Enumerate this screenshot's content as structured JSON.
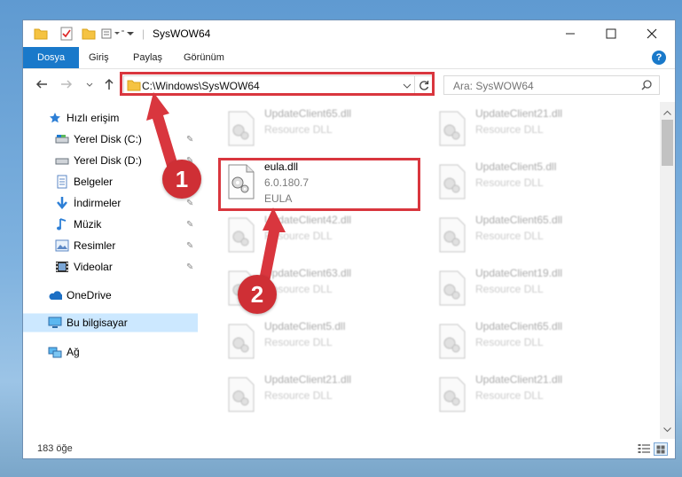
{
  "window": {
    "title": "SysWOW64",
    "controls": [
      "minimize-icon",
      "maximize-icon",
      "close-icon"
    ]
  },
  "ribbon": {
    "tabs": [
      {
        "label": "Dosya",
        "active": true
      },
      {
        "label": "Giriş",
        "active": false
      },
      {
        "label": "Paylaş",
        "active": false
      },
      {
        "label": "Görünüm",
        "active": false
      }
    ],
    "help": "?"
  },
  "address": {
    "path": "C:\\Windows\\SysWOW64"
  },
  "search": {
    "placeholder": "Ara: SysWOW64"
  },
  "navpane": {
    "items": [
      {
        "label": "Hızlı erişim",
        "icon": "star-icon",
        "pinned": false,
        "selected": false
      },
      {
        "label": "Yerel Disk (C:)",
        "icon": "drive-icon",
        "pinned": true,
        "selected": false
      },
      {
        "label": "Yerel Disk (D:)",
        "icon": "drive-icon",
        "pinned": true,
        "selected": false
      },
      {
        "label": "Belgeler",
        "icon": "documents-icon",
        "pinned": true,
        "selected": false
      },
      {
        "label": "İndirmeler",
        "icon": "download-icon",
        "pinned": true,
        "selected": false
      },
      {
        "label": "Müzik",
        "icon": "music-icon",
        "pinned": true,
        "selected": false
      },
      {
        "label": "Resimler",
        "icon": "pictures-icon",
        "pinned": true,
        "selected": false
      },
      {
        "label": "Videolar",
        "icon": "video-icon",
        "pinned": true,
        "selected": false
      },
      {
        "label": "OneDrive",
        "icon": "cloud-icon",
        "pinned": false,
        "selected": false
      },
      {
        "label": "Bu bilgisayar",
        "icon": "computer-icon",
        "pinned": false,
        "selected": true
      },
      {
        "label": "Ağ",
        "icon": "network-icon",
        "pinned": false,
        "selected": false
      }
    ]
  },
  "files": [
    {
      "name": "UpdateClient65.dll",
      "line2": "Resource DLL",
      "line3": "",
      "blurred": true
    },
    {
      "name": "UpdateClient21.dll",
      "line2": "Resource DLL",
      "line3": "",
      "blurred": true
    },
    {
      "name": "eula.dll",
      "line2": "6.0.180.7",
      "line3": "EULA",
      "blurred": false
    },
    {
      "name": "UpdateClient5.dll",
      "line2": "Resource DLL",
      "line3": "",
      "blurred": true
    },
    {
      "name": "UpdateClient42.dll",
      "line2": "Resource DLL",
      "line3": "",
      "blurred": true
    },
    {
      "name": "UpdateClient65.dll",
      "line2": "Resource DLL",
      "line3": "",
      "blurred": true
    },
    {
      "name": "UpdateClient63.dll",
      "line2": "Resource DLL",
      "line3": "",
      "blurred": true
    },
    {
      "name": "UpdateClient19.dll",
      "line2": "Resource DLL",
      "line3": "",
      "blurred": true
    },
    {
      "name": "UpdateClient5.dll",
      "line2": "Resource DLL",
      "line3": "",
      "blurred": true
    },
    {
      "name": "UpdateClient65.dll",
      "line2": "Resource DLL",
      "line3": "",
      "blurred": true
    },
    {
      "name": "UpdateClient21.dll",
      "line2": "Resource DLL",
      "line3": "",
      "blurred": true
    },
    {
      "name": "UpdateClient21.dll",
      "line2": "Resource DLL",
      "line3": "",
      "blurred": true
    }
  ],
  "status": {
    "count": "183 öğe"
  },
  "annotations": {
    "step1": "1",
    "step2": "2",
    "color": "#d9363e"
  },
  "colors": {
    "accent": "#1979ca",
    "selection": "#cce8ff",
    "folder": "#f5c342"
  }
}
